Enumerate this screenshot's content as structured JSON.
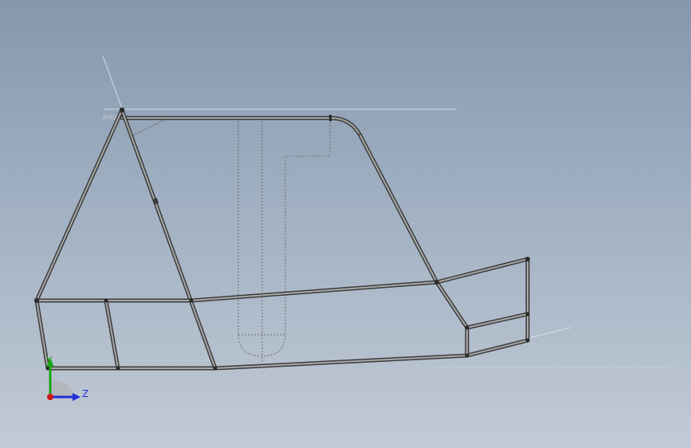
{
  "viewport": {
    "plane_label": "RHO",
    "background_top": "#8497ad",
    "background_bottom": "#c2cad5",
    "tube_color": "#3c3c3c",
    "tube_highlight": "#a8a8a8"
  },
  "triad": {
    "y_label": "Y",
    "z_label": "Z",
    "y_color": "#1aa51a",
    "z_color": "#1f2fd6",
    "x_color": "#d01818"
  }
}
